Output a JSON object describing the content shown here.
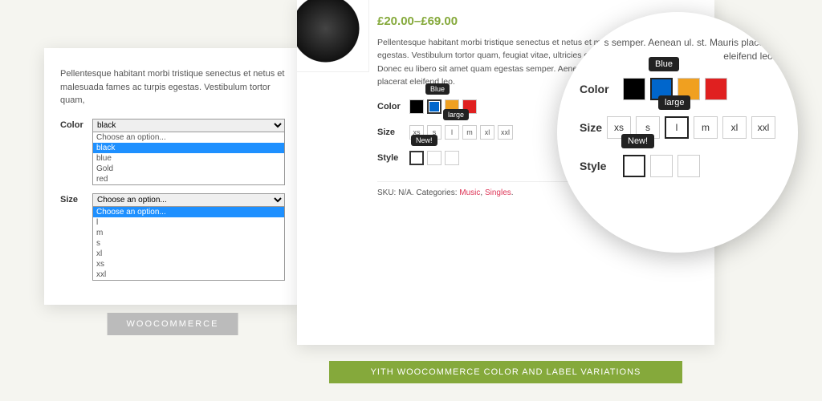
{
  "left": {
    "desc": "Pellentesque habitant morbi tristique senectus et netus et malesuada fames ac turpis egestas. Vestibulum tortor quam,",
    "color": {
      "label": "Color",
      "selected": "black",
      "placeholder": "Choose an option...",
      "options": [
        "black",
        "blue",
        "Gold",
        "red"
      ]
    },
    "size": {
      "label": "Size",
      "selected": "Choose an option...",
      "placeholder": "Choose an option...",
      "options": [
        "l",
        "m",
        "s",
        "xl",
        "xs",
        "xxl"
      ]
    },
    "badge": "WOOCOMMERCE"
  },
  "right": {
    "price": "£20.00–£69.00",
    "desc": "Pellentesque habitant morbi tristique senectus et netus et malesuada fames ac turpis egestas. Vestibulum tortor quam, feugiat vitae, ultricies eget, tempor sit amet, ante. Donec eu libero sit amet quam egestas semper. Aenean ultricies mi vitae est. Mauris placerat eleifend leo.",
    "color": {
      "label": "Color",
      "tooltip": "Blue",
      "swatches": [
        {
          "hex": "#000000",
          "name": "black"
        },
        {
          "hex": "#0066cc",
          "name": "blue",
          "selected": true
        },
        {
          "hex": "#f0a020",
          "name": "gold"
        },
        {
          "hex": "#e02020",
          "name": "red"
        }
      ]
    },
    "size": {
      "label": "Size",
      "tooltip": "large",
      "options": [
        "xs",
        "s",
        "l",
        "m",
        "xl",
        "xxl"
      ],
      "selected": "l"
    },
    "style": {
      "label": "Style",
      "tooltip": "New!",
      "shirts": [
        {
          "hex": "#e02020",
          "selected": true
        },
        {
          "hex": "#1050d0"
        },
        {
          "hex": "#f0c020"
        }
      ]
    },
    "meta": {
      "sku_label": "SKU:",
      "sku": "N/A.",
      "cat_label": "Categories:",
      "cats": [
        "Music",
        "Singles"
      ]
    },
    "badge": "YITH WOOCOMMERCE COLOR AND LABEL VARIATIONS"
  },
  "magnifier": {
    "topline": "s semper. Aenean ul.\nst. Mauris placerat eleifend leo.",
    "color": {
      "label": "Color",
      "tooltip": "Blue"
    },
    "size": {
      "label": "Size",
      "tooltip": "large"
    },
    "style": {
      "label": "Style",
      "tooltip": "New!"
    }
  }
}
